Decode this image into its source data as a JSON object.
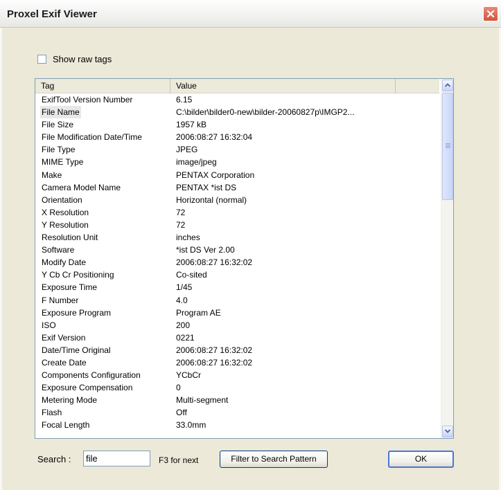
{
  "window": {
    "title": "Proxel Exif Viewer"
  },
  "options": {
    "show_raw_tags_label": "Show raw tags",
    "show_raw_tags_checked": false
  },
  "table": {
    "columns": [
      "Tag",
      "Value"
    ],
    "rows": [
      {
        "tag": "ExifTool Version Number",
        "value": "6.15"
      },
      {
        "tag": "File Name",
        "value": "C:\\bilder\\bilder0-new\\bilder-20060827p\\IMGP2...",
        "selected": true
      },
      {
        "tag": "File Size",
        "value": "1957 kB"
      },
      {
        "tag": "File Modification Date/Time",
        "value": "2006:08:27 16:32:04"
      },
      {
        "tag": "File Type",
        "value": "JPEG"
      },
      {
        "tag": "MIME Type",
        "value": "image/jpeg"
      },
      {
        "tag": "Make",
        "value": "PENTAX Corporation"
      },
      {
        "tag": "Camera Model Name",
        "value": "PENTAX *ist DS"
      },
      {
        "tag": "Orientation",
        "value": "Horizontal (normal)"
      },
      {
        "tag": "X Resolution",
        "value": "72"
      },
      {
        "tag": "Y Resolution",
        "value": "72"
      },
      {
        "tag": "Resolution Unit",
        "value": "inches"
      },
      {
        "tag": "Software",
        "value": "*ist DS     Ver 2.00"
      },
      {
        "tag": "Modify Date",
        "value": "2006:08:27 16:32:02"
      },
      {
        "tag": "Y Cb Cr Positioning",
        "value": "Co-sited"
      },
      {
        "tag": "Exposure Time",
        "value": "1/45"
      },
      {
        "tag": "F Number",
        "value": "4.0"
      },
      {
        "tag": "Exposure Program",
        "value": "Program AE"
      },
      {
        "tag": "ISO",
        "value": "200"
      },
      {
        "tag": "Exif Version",
        "value": "0221"
      },
      {
        "tag": "Date/Time Original",
        "value": "2006:08:27 16:32:02"
      },
      {
        "tag": "Create Date",
        "value": "2006:08:27 16:32:02"
      },
      {
        "tag": "Components Configuration",
        "value": "YCbCr"
      },
      {
        "tag": "Exposure Compensation",
        "value": "0"
      },
      {
        "tag": "Metering Mode",
        "value": "Multi-segment"
      },
      {
        "tag": "Flash",
        "value": "Off"
      },
      {
        "tag": "Focal Length",
        "value": "33.0mm"
      }
    ]
  },
  "search": {
    "label": "Search :",
    "value": "file",
    "hint": "F3 for next",
    "filter_button": "Filter to Search Pattern",
    "ok_button": "OK"
  },
  "colors": {
    "accent": "#4a77d6",
    "close": "#d4553d",
    "selection": "#e8e8e8"
  },
  "icons": {
    "close": "close-icon",
    "scroll_up": "chevron-up-icon",
    "scroll_down": "chevron-down-icon"
  }
}
